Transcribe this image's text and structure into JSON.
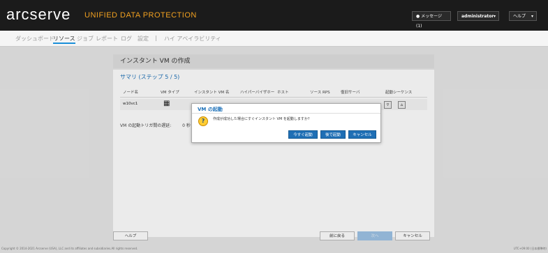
{
  "header": {
    "logo": "arcserve",
    "product": "UNIFIED DATA PROTECTION",
    "messages": "メッセージ (1)",
    "user": "administrator",
    "help": "ヘルプ"
  },
  "nav": {
    "items": [
      "ダッシュボード",
      "リソース",
      "ジョブ",
      "レポート",
      "ログ",
      "設定",
      "|",
      "ハイ アベイラビリティ"
    ]
  },
  "wizard": {
    "title": "インスタント VM の作成",
    "step": "サマリ (ステップ 5 / 5)",
    "columns": [
      "ノード名",
      "VM タイプ",
      "インスタント VM 名",
      "ハイパーバイザホー",
      "ホスト",
      "ソース RPS",
      "復旧サーバ",
      "起動シーケンス"
    ],
    "row": {
      "node": "w10vc1"
    },
    "delay_label": "VM の起動トリガ間の遅延:",
    "delay_value": "0 秒"
  },
  "footer": {
    "help": "ヘルプ",
    "back": "前に戻る",
    "next": "次へ",
    "cancel": "キャンセル"
  },
  "dialog": {
    "title": "VM の起動",
    "message": "作成が成功した場合にすぐインスタント VM を起動しますか?",
    "btn_now": "今すぐ起動",
    "btn_later": "後で起動",
    "btn_cancel": "キャンセル"
  },
  "status": {
    "copyright": "Copyright © 2014-2021 Arcserve (USA), LLC and its affiliates and subsidiaries.All rights reserved.",
    "datetime": "UTC+09:00 (日本標準時)"
  }
}
